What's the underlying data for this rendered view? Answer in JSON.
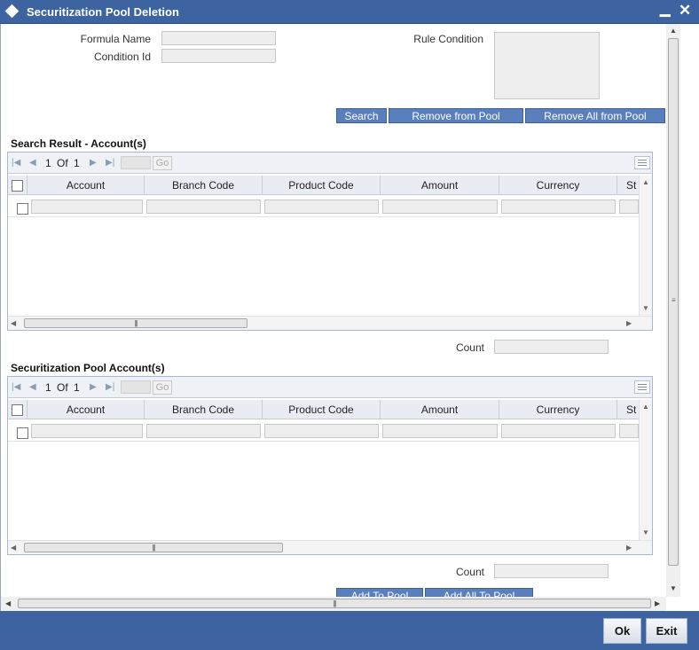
{
  "window": {
    "title": "Securitization Pool Deletion"
  },
  "form": {
    "formula_name_label": "Formula Name",
    "condition_id_label": "Condition Id",
    "rule_condition_label": "Rule Condition",
    "formula_name_value": "",
    "condition_id_value": "",
    "rule_condition_value": ""
  },
  "actions": {
    "search": "Search",
    "remove_from_pool": "Remove from Pool",
    "remove_all_from_pool": "Remove All from Pool",
    "add_to_pool": "Add To Pool",
    "add_all_to_pool": "Add All To Pool"
  },
  "search_result": {
    "title": "Search Result - Account(s)",
    "pager": {
      "page": "1",
      "of_label": "Of",
      "total": "1",
      "go_label": "Go"
    },
    "columns": [
      "Account",
      "Branch Code",
      "Product Code",
      "Amount",
      "Currency",
      "St"
    ],
    "count_label": "Count",
    "count_value": ""
  },
  "pool_accounts": {
    "title": "Securitization Pool Account(s)",
    "pager": {
      "page": "1",
      "of_label": "Of",
      "total": "1",
      "go_label": "Go"
    },
    "columns": [
      "Account",
      "Branch Code",
      "Product Code",
      "Amount",
      "Currency",
      "St"
    ],
    "count_label": "Count",
    "count_value": ""
  },
  "footer": {
    "ok": "Ok",
    "exit": "Exit"
  },
  "icons": {
    "title": "diamond-icon",
    "minimize": "minimize-icon",
    "close": "close-icon",
    "pager_first": "first-page-icon",
    "pager_prev": "prev-page-icon",
    "pager_next": "next-page-icon",
    "pager_last": "last-page-icon",
    "grid_settings": "grid-settings-icon"
  },
  "colors": {
    "titlebar": "#3d64a0",
    "button_bar": "#5a7fbd",
    "footer": "#3d64a0"
  }
}
